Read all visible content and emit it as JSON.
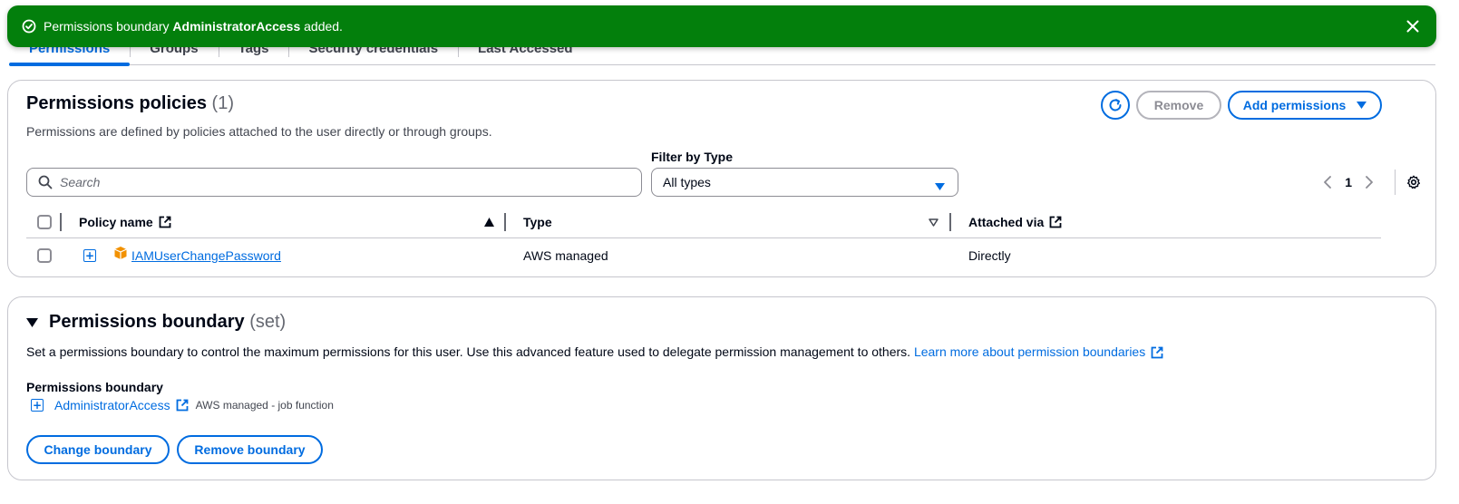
{
  "flash": {
    "prefix": "Permissions boundary ",
    "policy": "AdministratorAccess",
    "suffix": " added."
  },
  "tabs": [
    {
      "label": "Permissions",
      "active": true
    },
    {
      "label": "Groups"
    },
    {
      "label": "Tags"
    },
    {
      "label": "Security credentials"
    },
    {
      "label": "Last Accessed"
    }
  ],
  "policies": {
    "title": "Permissions policies",
    "count": "(1)",
    "description": "Permissions are defined by policies attached to the user directly or through groups.",
    "remove_label": "Remove",
    "add_label": "Add permissions",
    "search_placeholder": "Search",
    "filter_label": "Filter by Type",
    "filter_value": "All types",
    "page": "1",
    "columns": {
      "policy_name": "Policy name",
      "type": "Type",
      "attached_via": "Attached via"
    },
    "rows": [
      {
        "name": "IAMUserChangePassword",
        "type": "AWS managed",
        "attached_via": "Directly"
      }
    ]
  },
  "boundary": {
    "title": "Permissions boundary",
    "status": "(set)",
    "description": "Set a permissions boundary to control the maximum permissions for this user. Use this advanced feature used to delegate permission management to others.",
    "learn_more": "Learn more about permission boundaries",
    "label": "Permissions boundary",
    "policy_name": "AdministratorAccess",
    "policy_type": "AWS managed - job function",
    "change_label": "Change boundary",
    "remove_label": "Remove boundary"
  },
  "colors": {
    "accent": "#006ce0",
    "success": "#037f0c",
    "border": "#c6c6cd",
    "policy_icon": "#f29100"
  }
}
